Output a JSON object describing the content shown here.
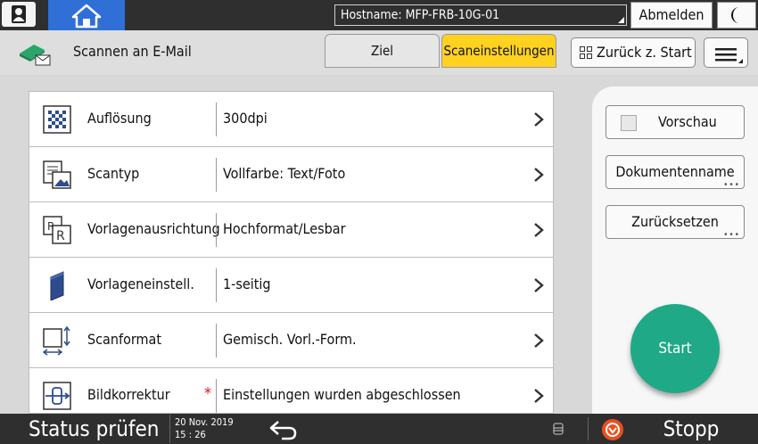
{
  "topbar": {
    "hostname": "Hostname: MFP-FRB-10G-01",
    "logout_label": "Abmelden"
  },
  "header": {
    "title": "Scannen an E-Mail",
    "tabs": [
      {
        "label": "Ziel",
        "active": false
      },
      {
        "label": "Scaneinstellungen",
        "active": true
      }
    ],
    "back_label": "Zurück z. Start"
  },
  "settings": [
    {
      "label": "Auflösung",
      "value": "300dpi",
      "icon": "resolution-icon",
      "required": false
    },
    {
      "label": "Scantyp",
      "value": "Vollfarbe: Text/Foto",
      "icon": "scan-type-icon",
      "required": false
    },
    {
      "label": "Vorlagenausrichtung",
      "value": "Hochformat/Lesbar",
      "icon": "orientation-icon",
      "required": false
    },
    {
      "label": "Vorlageneinstell.",
      "value": "1-seitig",
      "icon": "original-settings-icon",
      "required": false
    },
    {
      "label": "Scanformat",
      "value": "Gemisch. Vorl.-Form.",
      "icon": "scan-size-icon",
      "required": false
    },
    {
      "label": "Bildkorrektur",
      "value": "Einstellungen wurden abgeschlossen",
      "icon": "image-correction-icon",
      "required": true,
      "required_mark": "*"
    }
  ],
  "side": {
    "preview_label": "Vorschau",
    "document_name_label": "Dokumentenname",
    "reset_label": "Zurücksetzen",
    "start_label": "Start"
  },
  "bottombar": {
    "status_label": "Status prüfen",
    "date": "20 Nov. 2019",
    "time": "15 : 26",
    "stop_label": "Stopp"
  },
  "colors": {
    "accent_tab": "#ffd21f",
    "home": "#2f6fd6",
    "start": "#1fa987",
    "stop": "#e8501f"
  }
}
